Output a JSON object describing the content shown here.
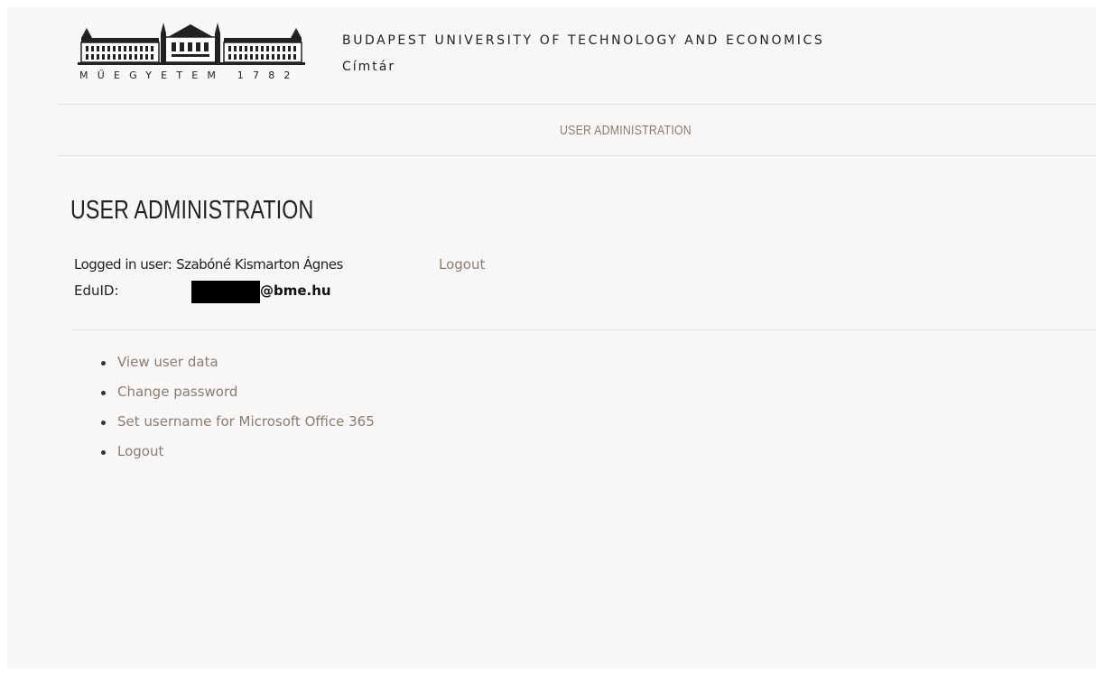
{
  "header": {
    "logo_caption": "MŰEGYETEM 1782",
    "university_name": "BUDAPEST UNIVERSITY OF TECHNOLOGY AND ECONOMICS",
    "site_name": "Címtár"
  },
  "nav": {
    "items": [
      {
        "label": "USER ADMINISTRATION"
      }
    ]
  },
  "main": {
    "title": "USER ADMINISTRATION",
    "logged_in_label": "Logged in user:",
    "logged_in_name": "Szabóné Kismarton Ágnes",
    "logout_label": "Logout",
    "eduid_label": "EduID:",
    "eduid_domain": "@bme.hu",
    "menu": [
      {
        "label": "View user data"
      },
      {
        "label": "Change password"
      },
      {
        "label": "Set username for Microsoft Office 365"
      },
      {
        "label": "Logout"
      }
    ]
  },
  "colors": {
    "link": "#8d7d6c",
    "text": "#222222",
    "background": "#f7f7f7",
    "divider": "#e3e3e3"
  }
}
